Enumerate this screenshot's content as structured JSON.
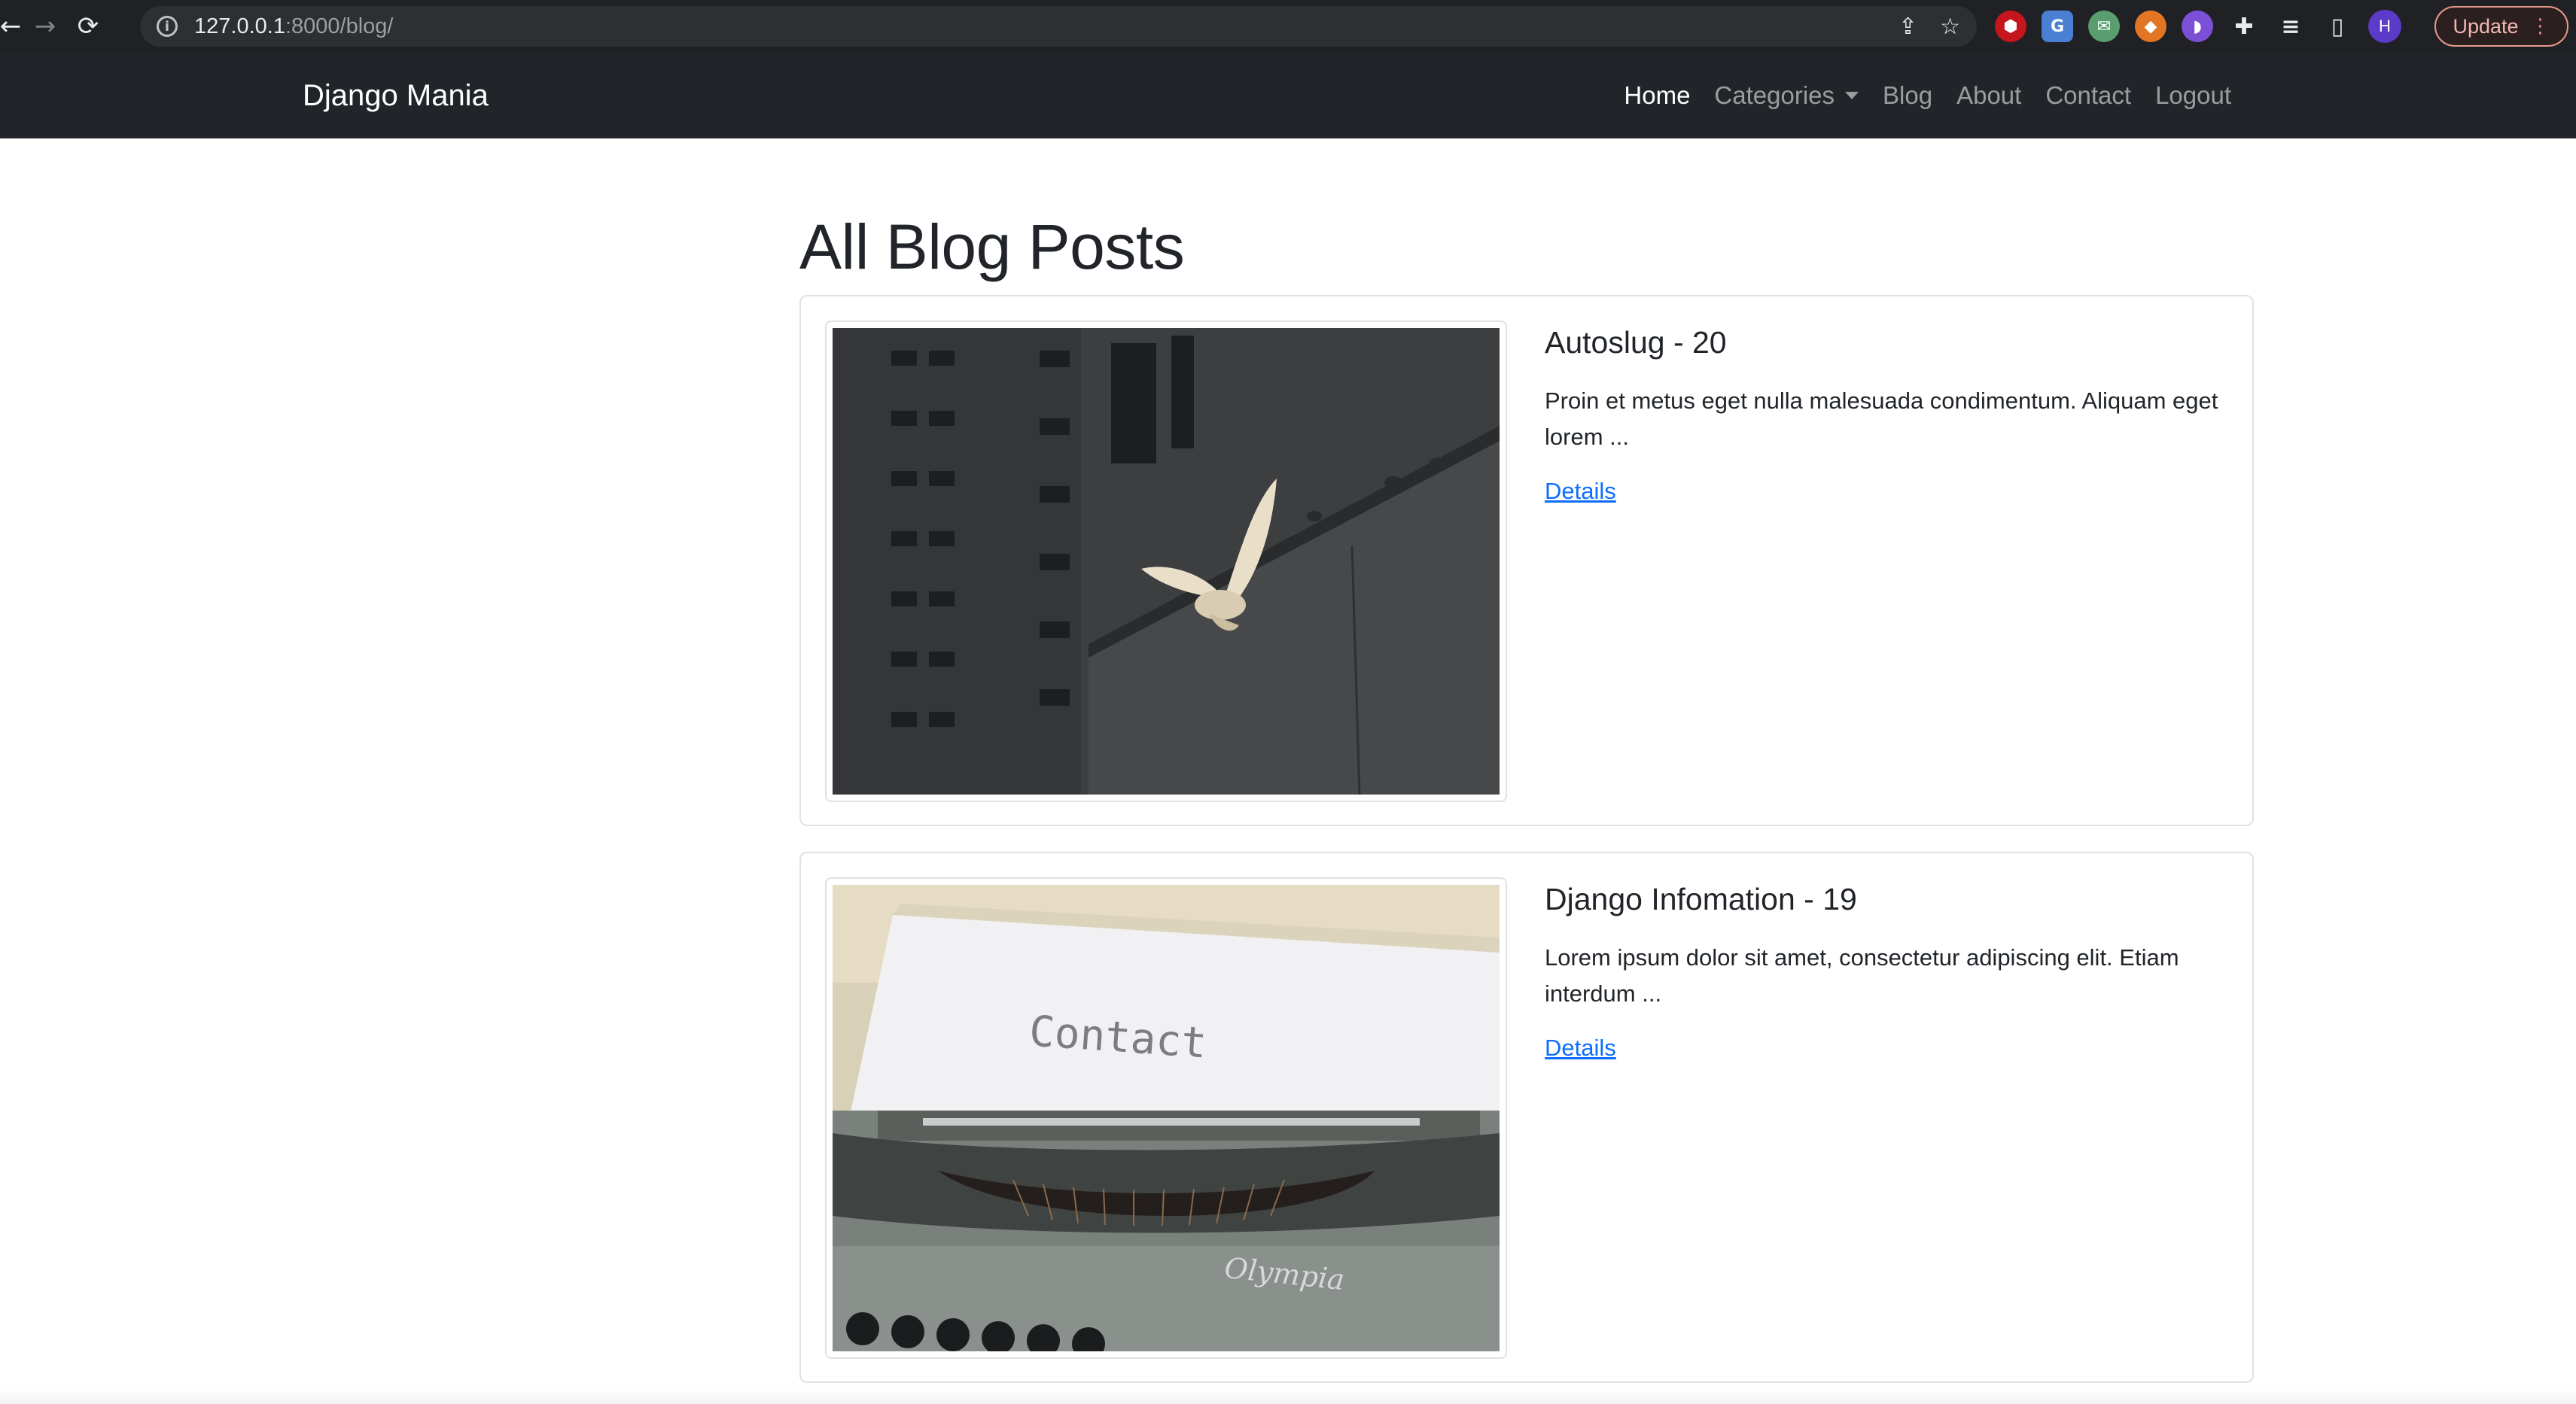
{
  "browser": {
    "url_host": "127.0.0.1",
    "url_path": ":8000/blog/",
    "update_label": "Update",
    "profile_initial": "H",
    "extensions": [
      "ublock-icon",
      "google-translate-icon",
      "mail-extension-icon",
      "metamask-icon",
      "extension-purple-icon",
      "puzzle-icon",
      "reading-list-icon",
      "side-panel-icon"
    ]
  },
  "navbar": {
    "brand": "Django Mania",
    "links": [
      {
        "label": "Home",
        "active": true
      },
      {
        "label": "Categories",
        "dropdown": true
      },
      {
        "label": "Blog"
      },
      {
        "label": "About"
      },
      {
        "label": "Contact"
      },
      {
        "label": "Logout"
      }
    ]
  },
  "page": {
    "title": "All Blog Posts"
  },
  "posts": [
    {
      "title": "Autoslug - 20",
      "excerpt": "Proin et metus eget nulla malesuada condimentum. Aliquam eget lorem ...",
      "link_label": "Details",
      "image": "dove-flying-by-building"
    },
    {
      "title": "Django Infomation - 19",
      "excerpt": "Lorem ipsum dolor sit amet, consectetur adipiscing elit. Etiam interdum ...",
      "link_label": "Details",
      "image": "typewriter-contact-paper",
      "image_text": "Contact",
      "image_brand": "Olympia"
    }
  ],
  "colors": {
    "navbar_bg": "#212529",
    "link": "#0d6efd",
    "chrome_bg": "#202124"
  }
}
